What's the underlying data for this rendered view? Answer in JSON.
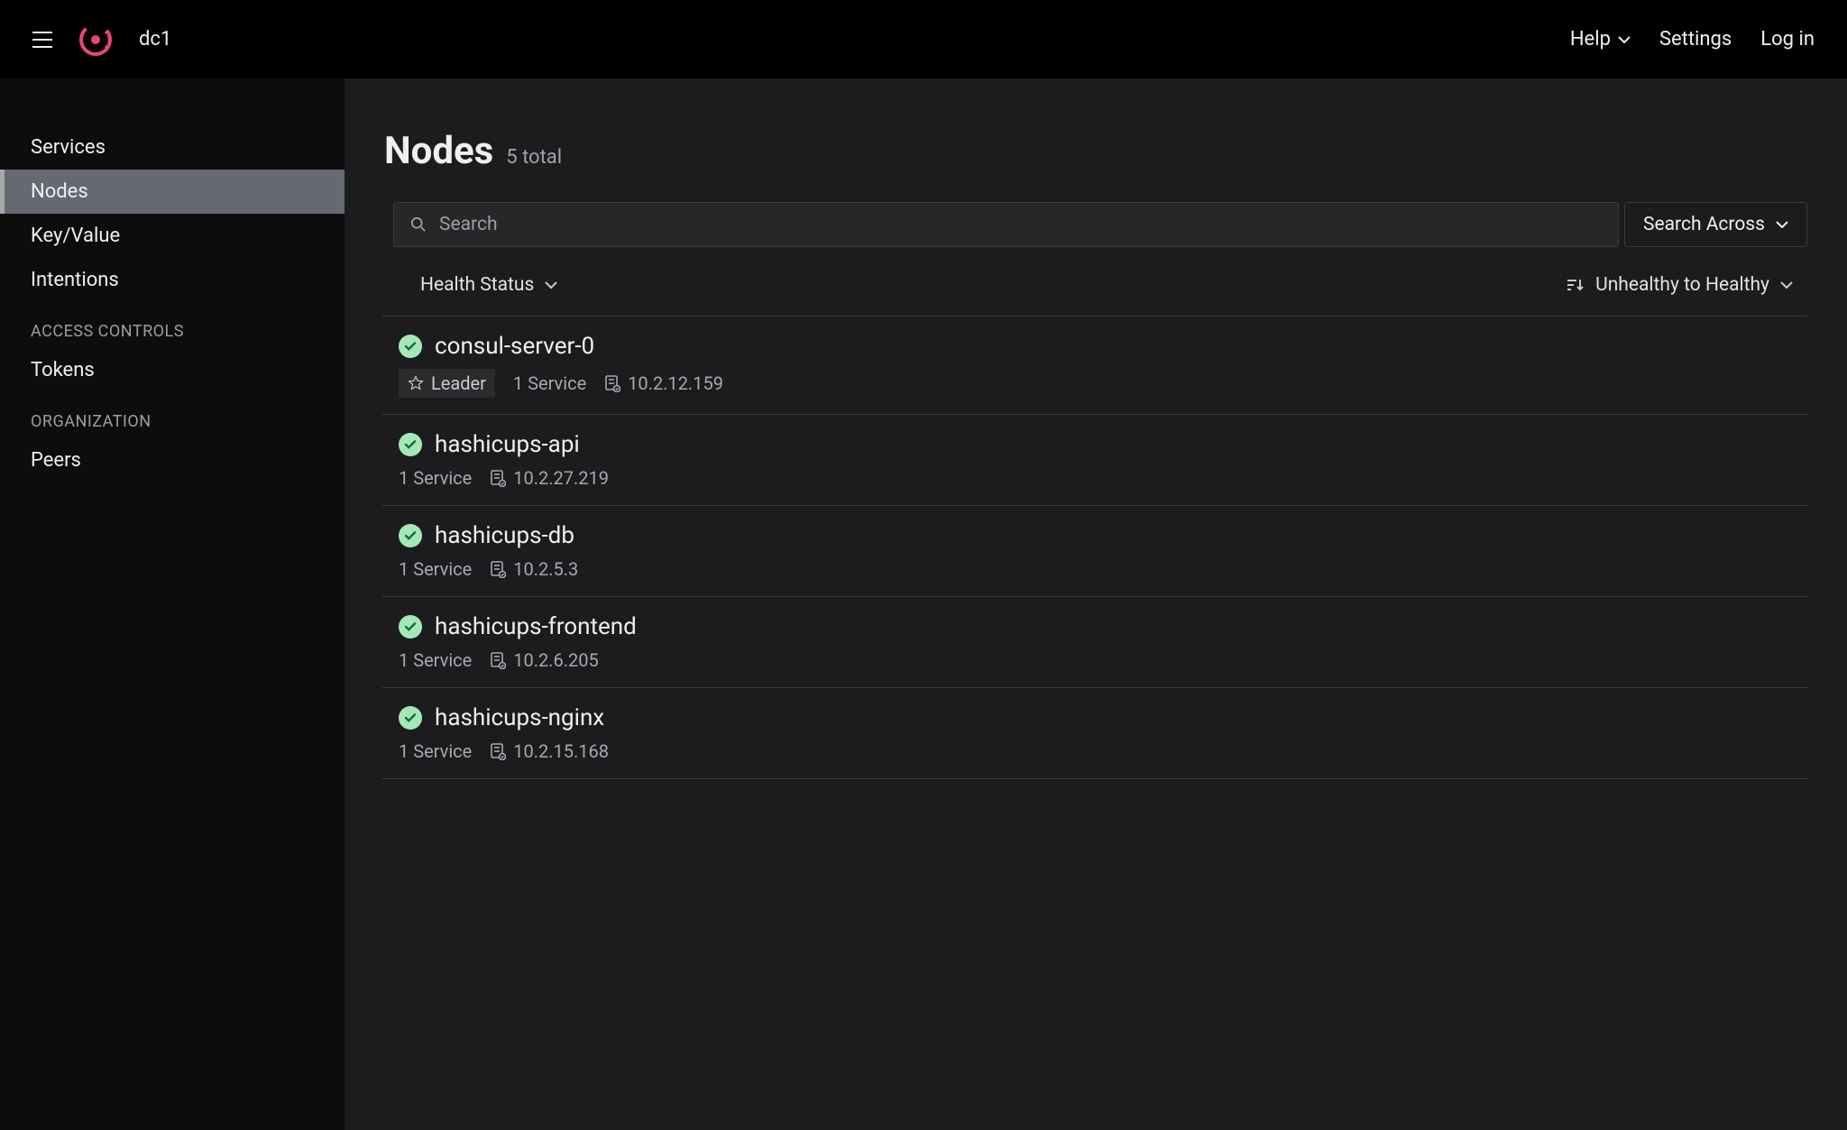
{
  "header": {
    "datacenter": "dc1",
    "help": "Help",
    "settings": "Settings",
    "login": "Log in"
  },
  "sidebar": {
    "nav": [
      {
        "key": "services",
        "label": "Services",
        "active": false
      },
      {
        "key": "nodes",
        "label": "Nodes",
        "active": true
      },
      {
        "key": "key-value",
        "label": "Key/Value",
        "active": false
      },
      {
        "key": "intentions",
        "label": "Intentions",
        "active": false
      }
    ],
    "access_heading": "ACCESS CONTROLS",
    "access_items": [
      {
        "key": "tokens",
        "label": "Tokens"
      }
    ],
    "org_heading": "ORGANIZATION",
    "org_items": [
      {
        "key": "peers",
        "label": "Peers"
      }
    ]
  },
  "main": {
    "title": "Nodes",
    "subtitle": "5 total",
    "search_placeholder": "Search",
    "search_across": "Search Across",
    "filter_health": "Health Status",
    "sort_label": "Unhealthy to Healthy"
  },
  "nodes": [
    {
      "name": "consul-server-0",
      "leader": true,
      "leader_label": "Leader",
      "services": "1 Service",
      "ip": "10.2.12.159"
    },
    {
      "name": "hashicups-api",
      "leader": false,
      "services": "1 Service",
      "ip": "10.2.27.219"
    },
    {
      "name": "hashicups-db",
      "leader": false,
      "services": "1 Service",
      "ip": "10.2.5.3"
    },
    {
      "name": "hashicups-frontend",
      "leader": false,
      "services": "1 Service",
      "ip": "10.2.6.205"
    },
    {
      "name": "hashicups-nginx",
      "leader": false,
      "services": "1 Service",
      "ip": "10.2.15.168"
    }
  ]
}
